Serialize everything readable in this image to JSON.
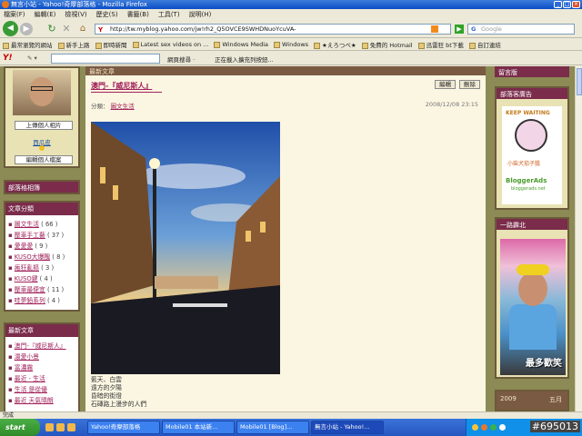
{
  "window": {
    "title": "無言小站 - Yahoo!奇摩部落格 - Mozilla Firefox"
  },
  "menu": [
    "檔案(F)",
    "編輯(E)",
    "檢視(V)",
    "歷史(S)",
    "書籤(B)",
    "工具(T)",
    "說明(H)"
  ],
  "nav": {
    "url": "http://tw.myblog.yahoo.com/jw!rh2_Q5OVCE9SWHDNuoYcuVA-",
    "search_placeholder": "Google"
  },
  "bookmarks": [
    "最常瀏覽的網站",
    "新手上路",
    "即時新聞",
    "Latest sex videos on ...",
    "Windows Media",
    "Windows",
    "★えろつべ★",
    "免費的 Hotmail",
    "迅雷狂 bt下載",
    "自訂連結"
  ],
  "yahoo_toolbar": {
    "search_label": "網頁搜尋 ·",
    "loading_text": "正在載入擴充列按鈕..."
  },
  "profile": {
    "upload_label": "上傳個人相片",
    "name": "西瓜皮",
    "edit_label": "編輯個人檔案"
  },
  "sidebar": {
    "links_title": "部落格相簿",
    "categories_title": "文章分類",
    "categories": [
      {
        "name": "圖文生活",
        "count": "( 66 )"
      },
      {
        "name": "壓車手工藝",
        "count": "( 37 )"
      },
      {
        "name": "愛愛愛",
        "count": "( 9 )"
      },
      {
        "name": "KUSO大爆醜",
        "count": "( 8 )"
      },
      {
        "name": "瘋狂亂摳",
        "count": "( 3 )"
      },
      {
        "name": "KUSO鍵",
        "count": "( 4 )"
      },
      {
        "name": "壓車最便宜",
        "count": "( 11 )"
      },
      {
        "name": "哇夢鉛系列",
        "count": "( 4 )"
      }
    ],
    "recent_title": "最新文章",
    "recent": [
      "澳門-『威尼斯人』",
      "澴愛小景",
      "富濃霧",
      "最近 - 生活",
      "生活 是從優",
      "最近 天氣晴朗"
    ]
  },
  "main": {
    "section_header": "最新文章",
    "post_title": "澳門-『威尼斯人』",
    "edit_label": "編輯",
    "delete_label": "刪除",
    "category_label": "分類：",
    "category": "圖文生活",
    "date": "2008/12/08 23:15",
    "caption": [
      "藍天、白雲",
      "遠方的夕陽",
      "昏暗的街燈",
      "石磚路上漫步的人們"
    ]
  },
  "right": {
    "guestbook_title": "留言版",
    "ad_title": "部落客廣告",
    "ad_keep": "KEEP WAITING",
    "ad_name": "小柴犬茄子醬",
    "ad_brand": "BloggerAds",
    "ad_url": "bloggerads.net",
    "north_title": "一路霹北",
    "north_label": "最多歡笑",
    "cal_year": "2009",
    "cal_month": "五月"
  },
  "status": {
    "text": "完成"
  },
  "taskbar": {
    "tasks": [
      "Yahoo!奇摩部落格",
      "Mobile01 本站新...",
      "Mobile01 [Blog]...",
      "無言小站 - Yahoo!..."
    ],
    "clock": "#695013"
  }
}
